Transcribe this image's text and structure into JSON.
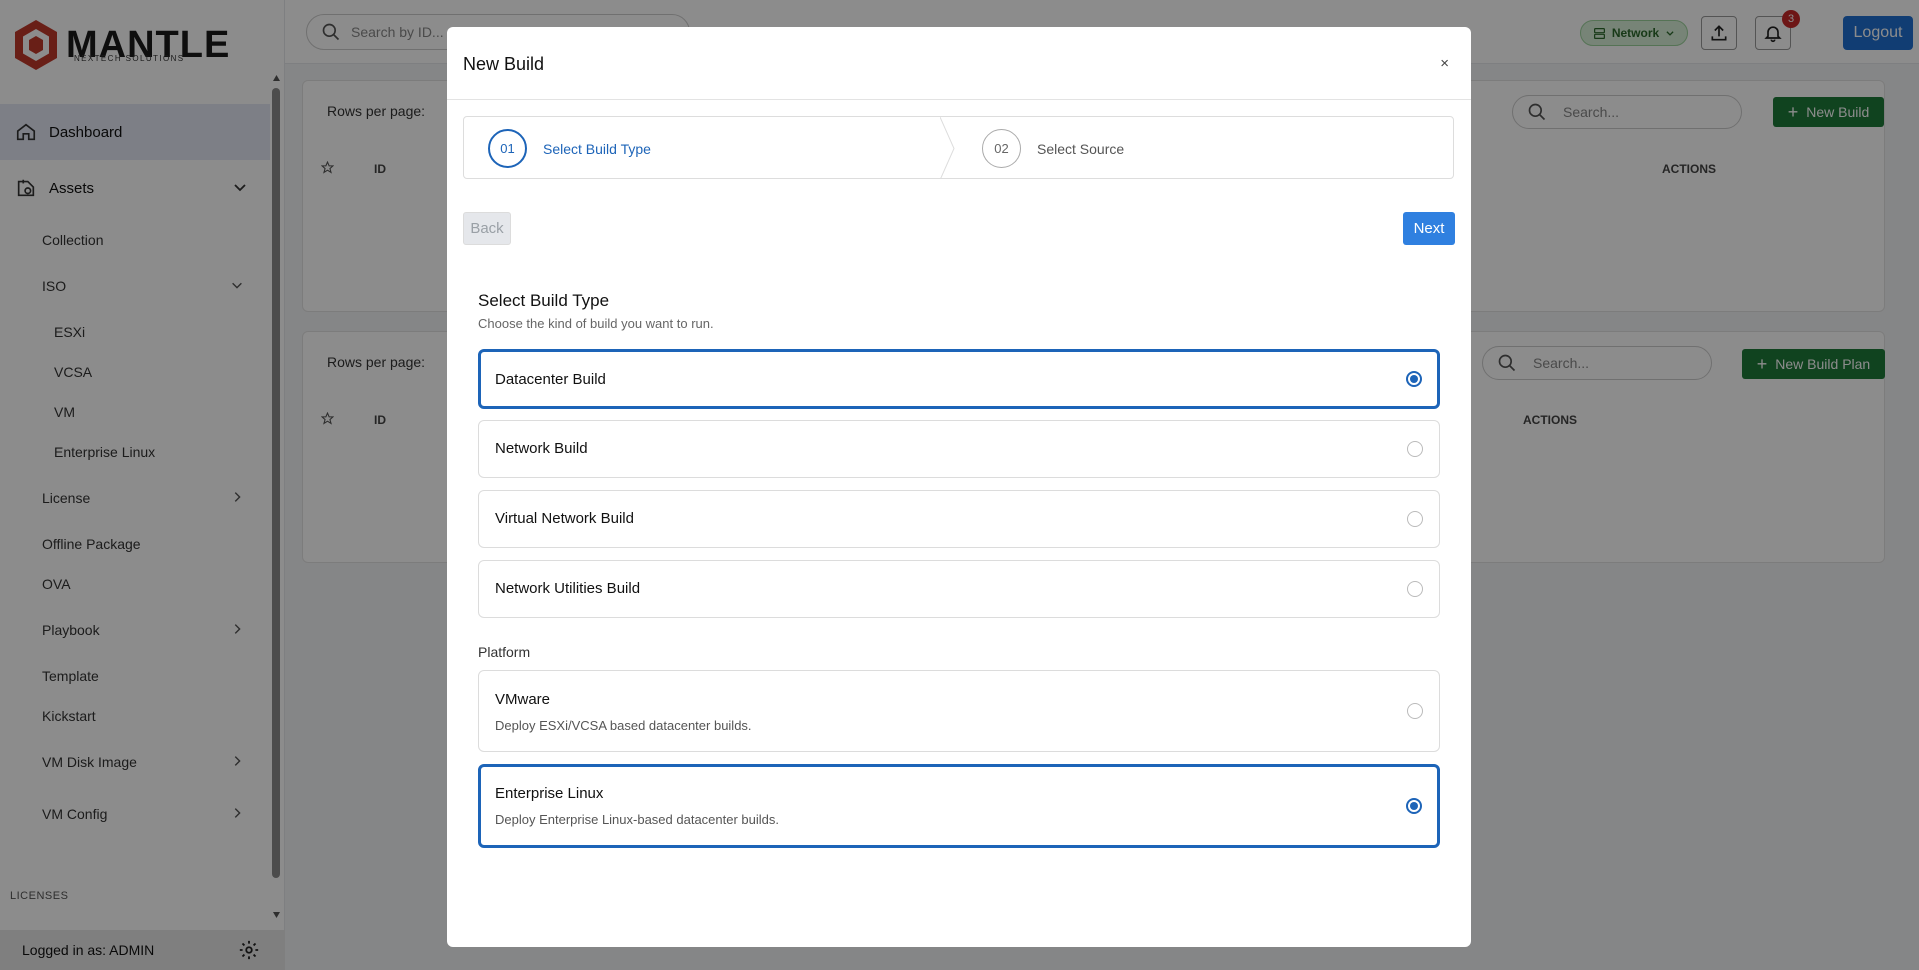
{
  "app": {
    "brand": "MANTLE",
    "brand_sub": "NEXTECH SOLUTIONS"
  },
  "sidebar": {
    "items": [
      {
        "label": "Dashboard"
      },
      {
        "label": "Assets"
      }
    ],
    "sub": {
      "collection": "Collection",
      "iso": "ISO",
      "esxi": "ESXi",
      "vcsa": "VCSA",
      "vm": "VM",
      "enterprise_linux": "Enterprise Linux",
      "license": "License",
      "offline_package": "Offline Package",
      "ova": "OVA",
      "playbook": "Playbook",
      "template": "Template",
      "kickstart": "Kickstart",
      "vm_disk_image": "VM Disk Image",
      "vm_config": "VM Config"
    },
    "licenses_label": "LICENSES",
    "logged_in": "Logged in as: ADMIN"
  },
  "topbar": {
    "search_placeholder": "Search by ID...",
    "network_label": "Network",
    "notification_count": "3",
    "logout_label": "Logout"
  },
  "background": {
    "rows_per_page": "Rows per page:",
    "search_placeholder": "Search...",
    "new_build": "New Build",
    "new_build_plan": "New Build Plan",
    "col_id": "ID",
    "col_actions": "ACTIONS"
  },
  "modal": {
    "title": "New Build",
    "close": "×",
    "steps": [
      {
        "num": "01",
        "label": "Select Build Type"
      },
      {
        "num": "02",
        "label": "Select Source"
      }
    ],
    "back_label": "Back",
    "next_label": "Next",
    "section_title": "Select Build Type",
    "section_sub": "Choose the kind of build you want to run.",
    "build_types": [
      {
        "label": "Datacenter Build",
        "selected": true
      },
      {
        "label": "Network Build",
        "selected": false
      },
      {
        "label": "Virtual Network Build",
        "selected": false
      },
      {
        "label": "Network Utilities Build",
        "selected": false
      }
    ],
    "platform_label": "Platform",
    "platforms": [
      {
        "label": "VMware",
        "desc": "Deploy ESXi/VCSA based datacenter builds.",
        "selected": false
      },
      {
        "label": "Enterprise Linux",
        "desc": "Deploy Enterprise Linux-based datacenter builds.",
        "selected": true
      }
    ]
  },
  "colors": {
    "accent": "#1d64b8",
    "primary_button": "#2f80e0",
    "success": "#1e7a3a",
    "logout": "#1f6fd1"
  }
}
